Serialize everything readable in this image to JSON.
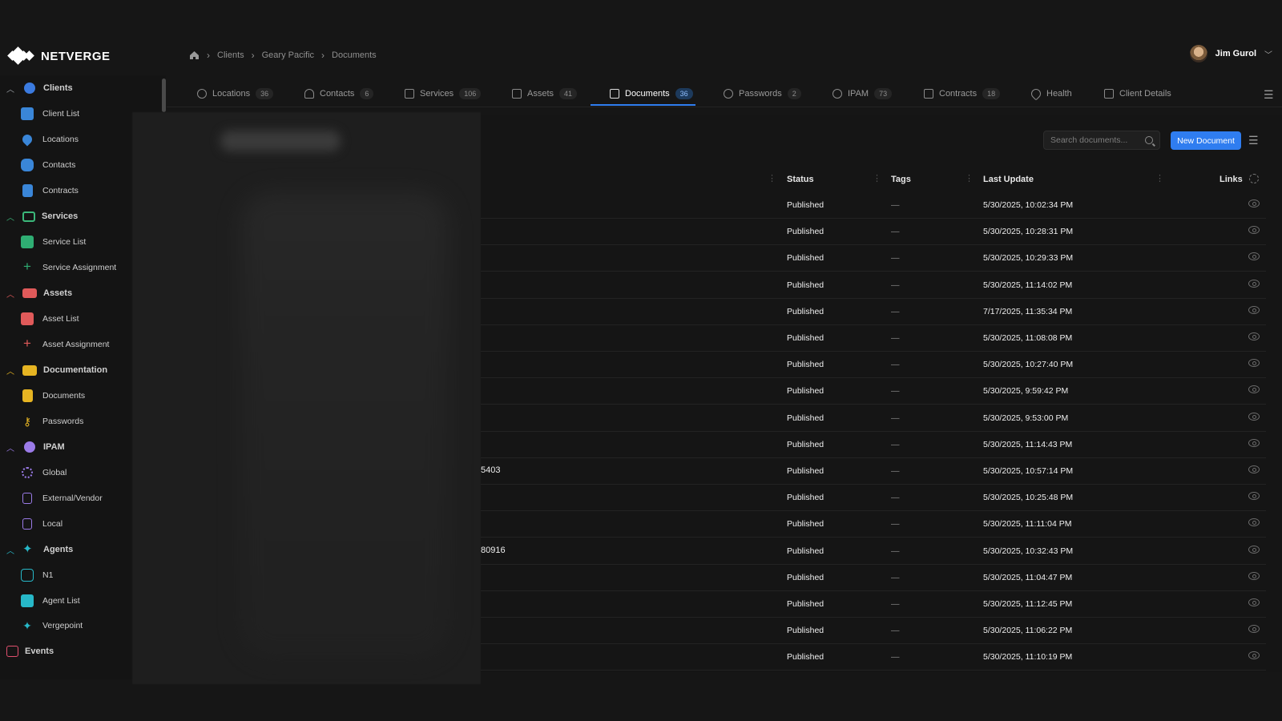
{
  "brand": {
    "name": "NETVERGE"
  },
  "breadcrumb": {
    "items": [
      "Clients",
      "Geary Pacific",
      "Documents"
    ]
  },
  "user": {
    "name": "Jim Gurol"
  },
  "sidebar": {
    "groups": [
      {
        "label": "Clients",
        "items": [
          "Client List",
          "Locations",
          "Contacts",
          "Contracts"
        ]
      },
      {
        "label": "Services",
        "items": [
          "Service List",
          "Service Assignment"
        ]
      },
      {
        "label": "Assets",
        "items": [
          "Asset List",
          "Asset Assignment"
        ]
      },
      {
        "label": "Documentation",
        "items": [
          "Documents",
          "Passwords"
        ]
      },
      {
        "label": "IPAM",
        "items": [
          "Global",
          "External/Vendor",
          "Local"
        ]
      },
      {
        "label": "Agents",
        "items": [
          "N1",
          "Agent List",
          "Vergepoint"
        ]
      }
    ],
    "events": "Events"
  },
  "tabs": [
    {
      "label": "Locations",
      "count": "36"
    },
    {
      "label": "Contacts",
      "count": "6"
    },
    {
      "label": "Services",
      "count": "106"
    },
    {
      "label": "Assets",
      "count": "41"
    },
    {
      "label": "Documents",
      "count": "36",
      "active": true
    },
    {
      "label": "Passwords",
      "count": "2"
    },
    {
      "label": "IPAM",
      "count": "73"
    },
    {
      "label": "Contracts",
      "count": "18"
    },
    {
      "label": "Health",
      "count": ""
    },
    {
      "label": "Client Details",
      "count": ""
    }
  ],
  "search": {
    "placeholder": "Search documents..."
  },
  "actions": {
    "new_document": "New Document"
  },
  "table": {
    "headers": {
      "status": "Status",
      "tags": "Tags",
      "last_update": "Last Update",
      "links": "Links"
    },
    "rows": [
      {
        "status": "Published",
        "tags": "—",
        "last_update": "5/30/2025, 10:02:34 PM"
      },
      {
        "status": "Published",
        "tags": "—",
        "last_update": "5/30/2025, 10:28:31 PM"
      },
      {
        "status": "Published",
        "tags": "—",
        "last_update": "5/30/2025, 10:29:33 PM"
      },
      {
        "status": "Published",
        "tags": "—",
        "last_update": "5/30/2025, 11:14:02 PM"
      },
      {
        "status": "Published",
        "tags": "—",
        "last_update": "7/17/2025, 11:35:34 PM"
      },
      {
        "status": "Published",
        "tags": "—",
        "last_update": "5/30/2025, 11:08:08 PM"
      },
      {
        "status": "Published",
        "tags": "—",
        "last_update": "5/30/2025, 10:27:40 PM"
      },
      {
        "status": "Published",
        "tags": "—",
        "last_update": "5/30/2025, 9:59:42 PM"
      },
      {
        "status": "Published",
        "tags": "—",
        "last_update": "5/30/2025, 9:53:00 PM"
      },
      {
        "status": "Published",
        "tags": "—",
        "last_update": "5/30/2025, 11:14:43 PM"
      },
      {
        "status": "Published",
        "tags": "—",
        "last_update": "5/30/2025, 10:57:14 PM",
        "name_fragment": "5403"
      },
      {
        "status": "Published",
        "tags": "—",
        "last_update": "5/30/2025, 10:25:48 PM"
      },
      {
        "status": "Published",
        "tags": "—",
        "last_update": "5/30/2025, 11:11:04 PM"
      },
      {
        "status": "Published",
        "tags": "—",
        "last_update": "5/30/2025, 10:32:43 PM",
        "name_fragment": "80916"
      },
      {
        "status": "Published",
        "tags": "—",
        "last_update": "5/30/2025, 11:04:47 PM"
      },
      {
        "status": "Published",
        "tags": "—",
        "last_update": "5/30/2025, 11:12:45 PM"
      },
      {
        "status": "Published",
        "tags": "—",
        "last_update": "5/30/2025, 11:06:22 PM"
      },
      {
        "status": "Published",
        "tags": "—",
        "last_update": "5/30/2025, 11:10:19 PM"
      }
    ]
  }
}
